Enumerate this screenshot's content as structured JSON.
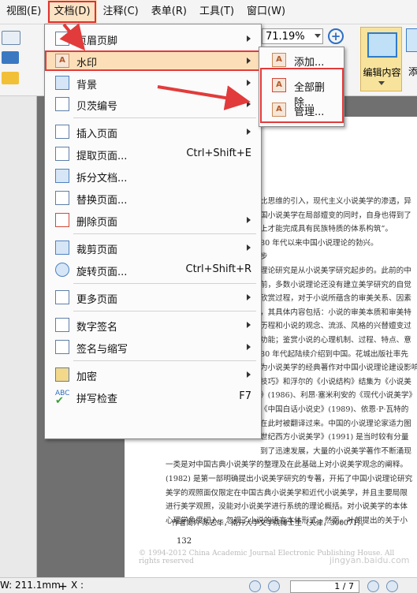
{
  "menubar": {
    "items": [
      {
        "label": "视图(E)"
      },
      {
        "label": "文档(D)"
      },
      {
        "label": "注释(C)"
      },
      {
        "label": "表单(R)"
      },
      {
        "label": "工具(T)"
      },
      {
        "label": "窗口(W)"
      }
    ]
  },
  "toolbar": {
    "zoom_value": "71.19%",
    "edit_content_label": "编辑内容",
    "edge_label": "添"
  },
  "document_menu": {
    "items": [
      {
        "label": "页眉页脚",
        "icon": "header-footer-icon",
        "submenu": true
      },
      {
        "label": "水印",
        "icon": "watermark-icon",
        "submenu": true
      },
      {
        "label": "背景",
        "icon": "background-icon",
        "submenu": true
      },
      {
        "label": "贝茨编号",
        "icon": "bates-number-icon",
        "submenu": true
      },
      {
        "label": "插入页面",
        "icon": "insert-page-icon",
        "submenu": true
      },
      {
        "label": "提取页面...",
        "icon": "extract-page-icon",
        "shortcut": "Ctrl+Shift+E"
      },
      {
        "label": "拆分文档...",
        "icon": "split-document-icon"
      },
      {
        "label": "替换页面...",
        "icon": "replace-page-icon"
      },
      {
        "label": "删除页面",
        "icon": "delete-page-icon",
        "submenu": true
      },
      {
        "label": "裁剪页面",
        "icon": "crop-page-icon",
        "submenu": true
      },
      {
        "label": "旋转页面...",
        "icon": "rotate-page-icon",
        "shortcut": "Ctrl+Shift+R"
      },
      {
        "label": "更多页面",
        "icon": "more-pages-icon",
        "submenu": true
      },
      {
        "label": "数字签名",
        "icon": "digital-signature-icon",
        "submenu": true
      },
      {
        "label": "签名与缩写",
        "icon": "sign-initials-icon",
        "submenu": true
      },
      {
        "label": "加密",
        "icon": "encrypt-icon",
        "submenu": true
      },
      {
        "label": "拼写检查",
        "icon": "spell-check-icon",
        "shortcut": "F7"
      }
    ]
  },
  "watermark_submenu": {
    "items": [
      {
        "label": "添加..."
      },
      {
        "label": "全部删除..."
      },
      {
        "label": "管理..."
      }
    ]
  },
  "page": {
    "lines": [
      "比思维的引入，现代主义小说美学的渗透，异",
      "国小说美学在局部嬗变的同时，自身也得到了",
      "上才能完成具有民族特质的体系构筑”。",
      "80 年代以来中国小说理论的勃兴。",
      "步",
      "理论研究是从小说美学研究起步的。此前的中",
      "前，多数小说理论还没有建立美学研究的自觉",
      "欣赏过程，对于小说所蕴含的审美关系、因素",
      "，其具体内容包括：小说的审美本质和审美特",
      "历程和小说的观念、流派、风格的兴替嬗变过",
      "功能；鉴赏小说的心理机制、过程、特点、意",
      "80 年代起陆续介绍到中国。花城出版社率先",
      "为小说美学的经典著作对中国小说理论建设影响",
      "技巧》和浮尔的《小说结构》结集为《小说美",
      "》(1986)、利昂·塞米利安的《现代小说美学》",
      "《中国白话小说史》(1989)、依恩·P·瓦特的",
      "在此时被翻译过来。中国的小说理论家适力图",
      "世纪西方小说美学》(1991) 是当时较有分量",
      "到了迅速发展，大量的小说美学著作不断涌现",
      "一类是对中国古典小说美学的整理及在此基础上对小说美学观念的阐释。",
      "(1982) 是第一部明确提出小说美学研究的专著，开拓了中国小说理论研究",
      "美学的观照面仅限定在中国古典小说美学和近代小说美学，并且主要局限",
      "进行美学观照，没能对小说美学进行系统的理论概括。对小说美学的本体",
      "心理学角度切入，忽视了小说的语言本体形式。然而，叶朗提出的关于小"
    ],
    "footnote": "作者简介  陈志华，南开大学文学院博士生（天津，300071）。",
    "page_number": "132",
    "copyright": "© 1994-2012 China Academic Journal Electronic Publishing House. All rights reserved",
    "site_watermark": "jingyan.baidu.com"
  },
  "statusbar": {
    "width_label": "W: 211.1mm",
    "x_label": "X :",
    "page_indicator": "1 / 7"
  },
  "colors": {
    "highlight_fill": "#fcdfb8",
    "annotation_red": "#e23b3b",
    "edit_button": "#f7e39c"
  }
}
